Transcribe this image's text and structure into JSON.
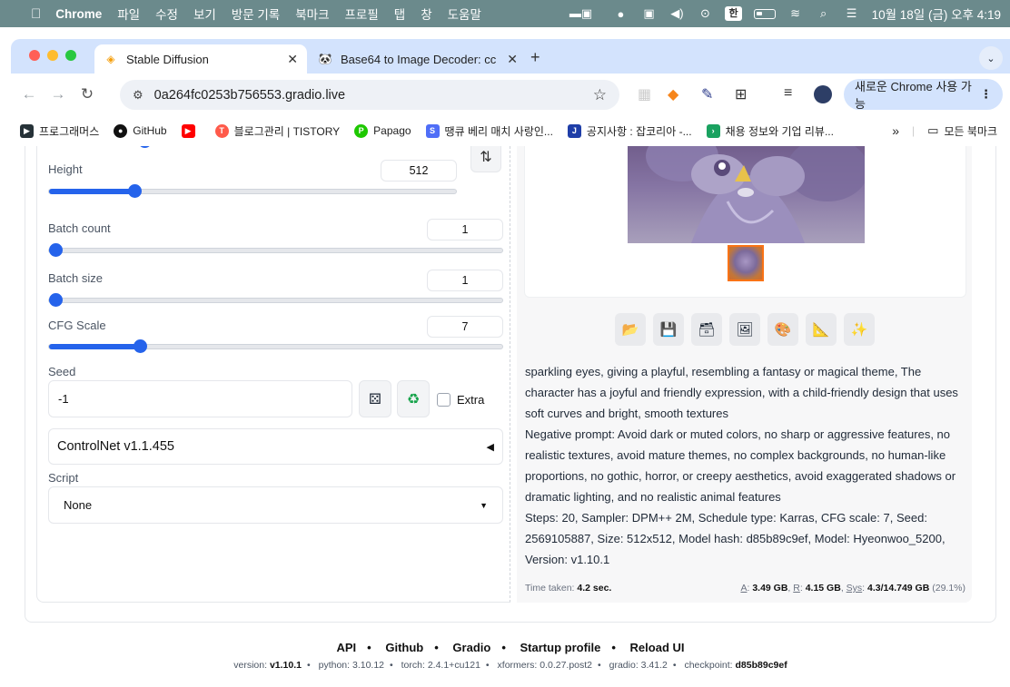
{
  "menubar": {
    "app": "Chrome",
    "items": [
      "파일",
      "수정",
      "보기",
      "방문 기록",
      "북마크",
      "프로필",
      "탭",
      "창",
      "도움말"
    ],
    "hangul_indicator": "한",
    "datetime": "10월 18일 (금) 오후 4:19"
  },
  "tabs": [
    {
      "title": "Stable Diffusion",
      "icon": "stable-diffusion-icon",
      "active": true
    },
    {
      "title": "Base64 to Image Decoder: cc",
      "icon": "base64-decoder-icon",
      "active": false
    }
  ],
  "omnibox": {
    "url": "0a264fc0253b756553.gradio.live"
  },
  "update_button": {
    "label": "새로운 Chrome 사용 가능"
  },
  "bookmarks": [
    {
      "label": "프로그래머스",
      "color": "#263238",
      "glyph": "▶"
    },
    {
      "label": "GitHub",
      "color": "#111111",
      "glyph": "●"
    },
    {
      "label": "",
      "color": "#ff0000",
      "glyph": "▶"
    },
    {
      "label": "블로그관리 | TISTORY",
      "color": "#ff5a4a",
      "glyph": "T"
    },
    {
      "label": "Papago",
      "color": "#1ec800",
      "glyph": "P"
    },
    {
      "label": "땡큐 베리 매치 사랑인...",
      "color": "#4f6ef7",
      "glyph": "S"
    },
    {
      "label": "공지사항 : 잡코리아 -...",
      "color": "#1f3ea8",
      "glyph": "J"
    },
    {
      "label": "채용 정보와 기업 리뷰...",
      "color": "#1aa260",
      "glyph": "›"
    }
  ],
  "bookmarks_more": {
    "chevron": "»",
    "all_label": "모든 북마크"
  },
  "params": {
    "height": {
      "label": "Height",
      "value": "512",
      "fraction": 0.21
    },
    "batch_count": {
      "label": "Batch count",
      "value": "1",
      "fraction": 0.0
    },
    "batch_size": {
      "label": "Batch size",
      "value": "1",
      "fraction": 0.0
    },
    "cfg_scale": {
      "label": "CFG Scale",
      "value": "7",
      "fraction": 0.2
    },
    "seed": {
      "label": "Seed",
      "value": "-1",
      "extra_label": "Extra"
    }
  },
  "controlnet": {
    "label": "ControlNet v1.1.455"
  },
  "script": {
    "label": "Script",
    "value": "None"
  },
  "image_toolbar": [
    "open-folder-icon",
    "save-icon",
    "zip-icon",
    "img2img-icon",
    "inpaint-icon",
    "extras-icon",
    "sparkle-icon"
  ],
  "info": {
    "prompt_tail": "sparkling eyes, giving a playful, resembling a fantasy or magical theme, The character has a joyful and friendly expression, with a child-friendly design that uses soft curves and bright, smooth textures",
    "negative": "Negative prompt: Avoid dark or muted colors, no sharp or aggressive features, no realistic textures, avoid mature themes, no complex backgrounds, no human-like proportions, no gothic, horror, or creepy aesthetics, avoid exaggerated shadows or dramatic lighting, and no realistic animal features",
    "params": "Steps: 20, Sampler: DPM++ 2M, Schedule type: Karras, CFG scale: 7, Seed: 2569105887, Size: 512x512, Model hash: d85b89c9ef, Model: Hyeonwoo_5200, Version: v1.10.1"
  },
  "timing": {
    "time_label": "Time taken:",
    "time_value": "4.2 sec.",
    "a_label": "A",
    "a_value": "3.49 GB",
    "r_label": "R",
    "r_value": "4.15 GB",
    "sys_label": "Sys",
    "sys_value": "4.3/14.749 GB",
    "sys_pct": "(29.1%)"
  },
  "footer": {
    "links": [
      "API",
      "Github",
      "Gradio",
      "Startup profile",
      "Reload UI"
    ],
    "versions": [
      {
        "label": "version:",
        "value": "v1.10.1",
        "bold": true
      },
      {
        "label": "python:",
        "value": "3.10.12",
        "bold": false
      },
      {
        "label": "torch:",
        "value": "2.4.1+cu121",
        "bold": false
      },
      {
        "label": "xformers:",
        "value": "0.0.27.post2",
        "bold": false
      },
      {
        "label": "gradio:",
        "value": "3.41.2",
        "bold": false
      },
      {
        "label": "checkpoint:",
        "value": "d85b89c9ef",
        "bold": true
      }
    ]
  }
}
